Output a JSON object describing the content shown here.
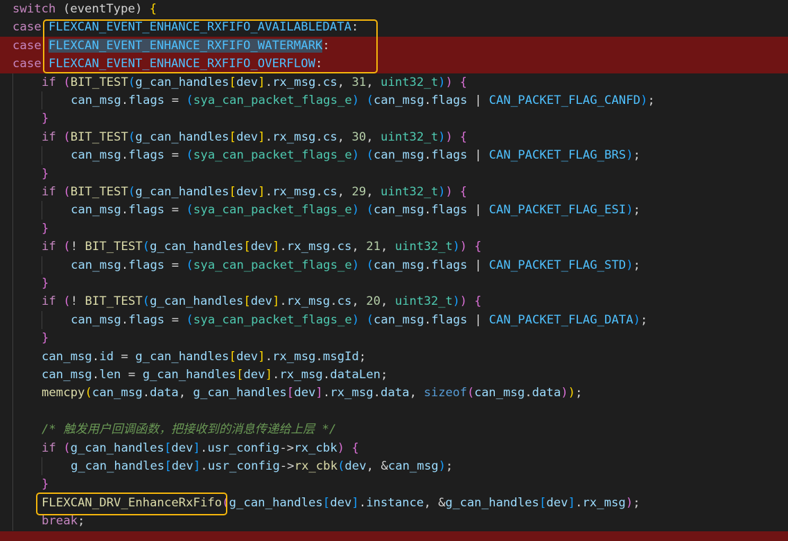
{
  "colors": {
    "background": "#1e1e1e",
    "highlight_line": "#6f1414",
    "annotation_box": "#f5b60c",
    "keyword": "#c586c0",
    "control": "#569cd6",
    "function": "#dcdcaa",
    "variable": "#9cdcfe",
    "type": "#4ec9b0",
    "number": "#b5cea8",
    "constant": "#4fc1ff",
    "comment": "#6a9955",
    "plain": "#d4d4d4",
    "bracket_gold": "#ffd700",
    "bracket_purple": "#da70d6",
    "bracket_blue": "#179fff"
  },
  "lines": [
    {
      "hl": false,
      "indent": 0,
      "tokens": [
        [
          "switch",
          "c"
        ],
        [
          " (",
          "p"
        ],
        [
          "eventType",
          "p"
        ],
        [
          ") ",
          "p"
        ],
        [
          "{",
          "bg"
        ]
      ]
    },
    {
      "hl": false,
      "indent": 0,
      "tokens": [
        [
          "case",
          "c"
        ],
        [
          " ",
          "p"
        ],
        [
          "FLEXCAN_EVENT_ENHANCE_RXFIFO_AVAILABLEDATA",
          "k"
        ],
        [
          ":",
          "p"
        ]
      ]
    },
    {
      "hl": true,
      "indent": 0,
      "tokens": [
        [
          "case",
          "c"
        ],
        [
          " ",
          "p"
        ],
        [
          "FLEXCAN_EVENT_ENHANCE_RXFIFO_WATERMARK",
          "ks"
        ],
        [
          ":",
          "p"
        ]
      ]
    },
    {
      "hl": true,
      "indent": 0,
      "tokens": [
        [
          "case",
          "c"
        ],
        [
          " ",
          "p"
        ],
        [
          "FLEXCAN_EVENT_ENHANCE_RXFIFO_OVERFLOW",
          "k"
        ],
        [
          ":",
          "p"
        ]
      ]
    },
    {
      "hl": false,
      "indent": 1,
      "tokens": [
        [
          "if",
          "c"
        ],
        [
          " ",
          "p"
        ],
        [
          "(",
          "bp"
        ],
        [
          "BIT_TEST",
          "f"
        ],
        [
          "(",
          "bb"
        ],
        [
          "g_can_handles",
          "v"
        ],
        [
          "[",
          "bg"
        ],
        [
          "dev",
          "v"
        ],
        [
          "]",
          "bg"
        ],
        [
          ".",
          "p"
        ],
        [
          "rx_msg",
          "v"
        ],
        [
          ".",
          "p"
        ],
        [
          "cs",
          "v"
        ],
        [
          ", ",
          "p"
        ],
        [
          "31",
          "n"
        ],
        [
          ", ",
          "p"
        ],
        [
          "uint32_t",
          "t"
        ],
        [
          ")",
          "bb"
        ],
        [
          ")",
          "bp"
        ],
        [
          " ",
          "p"
        ],
        [
          "{",
          "bp"
        ]
      ]
    },
    {
      "hl": false,
      "indent": 2,
      "tokens": [
        [
          "can_msg",
          "v"
        ],
        [
          ".",
          "p"
        ],
        [
          "flags",
          "v"
        ],
        [
          " = ",
          "p"
        ],
        [
          "(",
          "bb"
        ],
        [
          "sya_can_packet_flags_e",
          "t"
        ],
        [
          ")",
          "bb"
        ],
        [
          " ",
          "p"
        ],
        [
          "(",
          "bb"
        ],
        [
          "can_msg",
          "v"
        ],
        [
          ".",
          "p"
        ],
        [
          "flags",
          "v"
        ],
        [
          " | ",
          "p"
        ],
        [
          "CAN_PACKET_FLAG_CANFD",
          "k"
        ],
        [
          ")",
          "bb"
        ],
        [
          ";",
          "p"
        ]
      ]
    },
    {
      "hl": false,
      "indent": 1,
      "tokens": [
        [
          "}",
          "bp"
        ]
      ]
    },
    {
      "hl": false,
      "indent": 1,
      "tokens": [
        [
          "if",
          "c"
        ],
        [
          " ",
          "p"
        ],
        [
          "(",
          "bp"
        ],
        [
          "BIT_TEST",
          "f"
        ],
        [
          "(",
          "bb"
        ],
        [
          "g_can_handles",
          "v"
        ],
        [
          "[",
          "bg"
        ],
        [
          "dev",
          "v"
        ],
        [
          "]",
          "bg"
        ],
        [
          ".",
          "p"
        ],
        [
          "rx_msg",
          "v"
        ],
        [
          ".",
          "p"
        ],
        [
          "cs",
          "v"
        ],
        [
          ", ",
          "p"
        ],
        [
          "30",
          "n"
        ],
        [
          ", ",
          "p"
        ],
        [
          "uint32_t",
          "t"
        ],
        [
          ")",
          "bb"
        ],
        [
          ")",
          "bp"
        ],
        [
          " ",
          "p"
        ],
        [
          "{",
          "bp"
        ]
      ]
    },
    {
      "hl": false,
      "indent": 2,
      "tokens": [
        [
          "can_msg",
          "v"
        ],
        [
          ".",
          "p"
        ],
        [
          "flags",
          "v"
        ],
        [
          " = ",
          "p"
        ],
        [
          "(",
          "bb"
        ],
        [
          "sya_can_packet_flags_e",
          "t"
        ],
        [
          ")",
          "bb"
        ],
        [
          " ",
          "p"
        ],
        [
          "(",
          "bb"
        ],
        [
          "can_msg",
          "v"
        ],
        [
          ".",
          "p"
        ],
        [
          "flags",
          "v"
        ],
        [
          " | ",
          "p"
        ],
        [
          "CAN_PACKET_FLAG_BRS",
          "k"
        ],
        [
          ")",
          "bb"
        ],
        [
          ";",
          "p"
        ]
      ]
    },
    {
      "hl": false,
      "indent": 1,
      "tokens": [
        [
          "}",
          "bp"
        ]
      ]
    },
    {
      "hl": false,
      "indent": 1,
      "tokens": [
        [
          "if",
          "c"
        ],
        [
          " ",
          "p"
        ],
        [
          "(",
          "bp"
        ],
        [
          "BIT_TEST",
          "f"
        ],
        [
          "(",
          "bb"
        ],
        [
          "g_can_handles",
          "v"
        ],
        [
          "[",
          "bg"
        ],
        [
          "dev",
          "v"
        ],
        [
          "]",
          "bg"
        ],
        [
          ".",
          "p"
        ],
        [
          "rx_msg",
          "v"
        ],
        [
          ".",
          "p"
        ],
        [
          "cs",
          "v"
        ],
        [
          ", ",
          "p"
        ],
        [
          "29",
          "n"
        ],
        [
          ", ",
          "p"
        ],
        [
          "uint32_t",
          "t"
        ],
        [
          ")",
          "bb"
        ],
        [
          ")",
          "bp"
        ],
        [
          " ",
          "p"
        ],
        [
          "{",
          "bp"
        ]
      ]
    },
    {
      "hl": false,
      "indent": 2,
      "tokens": [
        [
          "can_msg",
          "v"
        ],
        [
          ".",
          "p"
        ],
        [
          "flags",
          "v"
        ],
        [
          " = ",
          "p"
        ],
        [
          "(",
          "bb"
        ],
        [
          "sya_can_packet_flags_e",
          "t"
        ],
        [
          ")",
          "bb"
        ],
        [
          " ",
          "p"
        ],
        [
          "(",
          "bb"
        ],
        [
          "can_msg",
          "v"
        ],
        [
          ".",
          "p"
        ],
        [
          "flags",
          "v"
        ],
        [
          " | ",
          "p"
        ],
        [
          "CAN_PACKET_FLAG_ESI",
          "k"
        ],
        [
          ")",
          "bb"
        ],
        [
          ";",
          "p"
        ]
      ]
    },
    {
      "hl": false,
      "indent": 1,
      "tokens": [
        [
          "}",
          "bp"
        ]
      ]
    },
    {
      "hl": false,
      "indent": 1,
      "tokens": [
        [
          "if",
          "c"
        ],
        [
          " ",
          "p"
        ],
        [
          "(",
          "bp"
        ],
        [
          "! ",
          "p"
        ],
        [
          "BIT_TEST",
          "f"
        ],
        [
          "(",
          "bb"
        ],
        [
          "g_can_handles",
          "v"
        ],
        [
          "[",
          "bg"
        ],
        [
          "dev",
          "v"
        ],
        [
          "]",
          "bg"
        ],
        [
          ".",
          "p"
        ],
        [
          "rx_msg",
          "v"
        ],
        [
          ".",
          "p"
        ],
        [
          "cs",
          "v"
        ],
        [
          ", ",
          "p"
        ],
        [
          "21",
          "n"
        ],
        [
          ", ",
          "p"
        ],
        [
          "uint32_t",
          "t"
        ],
        [
          ")",
          "bb"
        ],
        [
          ")",
          "bp"
        ],
        [
          " ",
          "p"
        ],
        [
          "{",
          "bp"
        ]
      ]
    },
    {
      "hl": false,
      "indent": 2,
      "tokens": [
        [
          "can_msg",
          "v"
        ],
        [
          ".",
          "p"
        ],
        [
          "flags",
          "v"
        ],
        [
          " = ",
          "p"
        ],
        [
          "(",
          "bb"
        ],
        [
          "sya_can_packet_flags_e",
          "t"
        ],
        [
          ")",
          "bb"
        ],
        [
          " ",
          "p"
        ],
        [
          "(",
          "bb"
        ],
        [
          "can_msg",
          "v"
        ],
        [
          ".",
          "p"
        ],
        [
          "flags",
          "v"
        ],
        [
          " | ",
          "p"
        ],
        [
          "CAN_PACKET_FLAG_STD",
          "k"
        ],
        [
          ")",
          "bb"
        ],
        [
          ";",
          "p"
        ]
      ]
    },
    {
      "hl": false,
      "indent": 1,
      "tokens": [
        [
          "}",
          "bp"
        ]
      ]
    },
    {
      "hl": false,
      "indent": 1,
      "tokens": [
        [
          "if",
          "c"
        ],
        [
          " ",
          "p"
        ],
        [
          "(",
          "bp"
        ],
        [
          "! ",
          "p"
        ],
        [
          "BIT_TEST",
          "f"
        ],
        [
          "(",
          "bb"
        ],
        [
          "g_can_handles",
          "v"
        ],
        [
          "[",
          "bg"
        ],
        [
          "dev",
          "v"
        ],
        [
          "]",
          "bg"
        ],
        [
          ".",
          "p"
        ],
        [
          "rx_msg",
          "v"
        ],
        [
          ".",
          "p"
        ],
        [
          "cs",
          "v"
        ],
        [
          ", ",
          "p"
        ],
        [
          "20",
          "n"
        ],
        [
          ", ",
          "p"
        ],
        [
          "uint32_t",
          "t"
        ],
        [
          ")",
          "bb"
        ],
        [
          ")",
          "bp"
        ],
        [
          " ",
          "p"
        ],
        [
          "{",
          "bp"
        ]
      ]
    },
    {
      "hl": false,
      "indent": 2,
      "tokens": [
        [
          "can_msg",
          "v"
        ],
        [
          ".",
          "p"
        ],
        [
          "flags",
          "v"
        ],
        [
          " = ",
          "p"
        ],
        [
          "(",
          "bb"
        ],
        [
          "sya_can_packet_flags_e",
          "t"
        ],
        [
          ")",
          "bb"
        ],
        [
          " ",
          "p"
        ],
        [
          "(",
          "bb"
        ],
        [
          "can_msg",
          "v"
        ],
        [
          ".",
          "p"
        ],
        [
          "flags",
          "v"
        ],
        [
          " | ",
          "p"
        ],
        [
          "CAN_PACKET_FLAG_DATA",
          "k"
        ],
        [
          ")",
          "bb"
        ],
        [
          ";",
          "p"
        ]
      ]
    },
    {
      "hl": false,
      "indent": 1,
      "tokens": [
        [
          "}",
          "bp"
        ]
      ]
    },
    {
      "hl": false,
      "indent": 1,
      "tokens": [
        [
          "can_msg",
          "v"
        ],
        [
          ".",
          "p"
        ],
        [
          "id",
          "v"
        ],
        [
          " = ",
          "p"
        ],
        [
          "g_can_handles",
          "v"
        ],
        [
          "[",
          "bg"
        ],
        [
          "dev",
          "v"
        ],
        [
          "]",
          "bg"
        ],
        [
          ".",
          "p"
        ],
        [
          "rx_msg",
          "v"
        ],
        [
          ".",
          "p"
        ],
        [
          "msgId",
          "v"
        ],
        [
          ";",
          "p"
        ]
      ]
    },
    {
      "hl": false,
      "indent": 1,
      "tokens": [
        [
          "can_msg",
          "v"
        ],
        [
          ".",
          "p"
        ],
        [
          "len",
          "v"
        ],
        [
          " = ",
          "p"
        ],
        [
          "g_can_handles",
          "v"
        ],
        [
          "[",
          "bg"
        ],
        [
          "dev",
          "v"
        ],
        [
          "]",
          "bg"
        ],
        [
          ".",
          "p"
        ],
        [
          "rx_msg",
          "v"
        ],
        [
          ".",
          "p"
        ],
        [
          "dataLen",
          "v"
        ],
        [
          ";",
          "p"
        ]
      ]
    },
    {
      "hl": false,
      "indent": 1,
      "tokens": [
        [
          "memcpy",
          "f"
        ],
        [
          "(",
          "bg"
        ],
        [
          "can_msg",
          "v"
        ],
        [
          ".",
          "p"
        ],
        [
          "data",
          "v"
        ],
        [
          ", ",
          "p"
        ],
        [
          "g_can_handles",
          "v"
        ],
        [
          "[",
          "bp"
        ],
        [
          "dev",
          "v"
        ],
        [
          "]",
          "bp"
        ],
        [
          ".",
          "p"
        ],
        [
          "rx_msg",
          "v"
        ],
        [
          ".",
          "p"
        ],
        [
          "data",
          "v"
        ],
        [
          ", ",
          "p"
        ],
        [
          "sizeof",
          "control"
        ],
        [
          "(",
          "bp"
        ],
        [
          "can_msg",
          "v"
        ],
        [
          ".",
          "p"
        ],
        [
          "data",
          "v"
        ],
        [
          ")",
          "bp"
        ],
        [
          ")",
          "bg"
        ],
        [
          ";",
          "p"
        ]
      ]
    },
    {
      "hl": false,
      "indent": 1,
      "tokens": []
    },
    {
      "hl": false,
      "indent": 1,
      "tokens": [
        [
          "/* 触发用户回调函数，把接收到的消息传递给上层 */",
          "cm"
        ]
      ]
    },
    {
      "hl": false,
      "indent": 1,
      "tokens": [
        [
          "if",
          "c"
        ],
        [
          " ",
          "p"
        ],
        [
          "(",
          "bp"
        ],
        [
          "g_can_handles",
          "v"
        ],
        [
          "[",
          "bb"
        ],
        [
          "dev",
          "v"
        ],
        [
          "]",
          "bb"
        ],
        [
          ".",
          "p"
        ],
        [
          "usr_config",
          "v"
        ],
        [
          "->",
          "p"
        ],
        [
          "rx_cbk",
          "v"
        ],
        [
          ")",
          "bp"
        ],
        [
          " ",
          "p"
        ],
        [
          "{",
          "bp"
        ]
      ]
    },
    {
      "hl": false,
      "indent": 2,
      "tokens": [
        [
          "g_can_handles",
          "v"
        ],
        [
          "[",
          "bb"
        ],
        [
          "dev",
          "v"
        ],
        [
          "]",
          "bb"
        ],
        [
          ".",
          "p"
        ],
        [
          "usr_config",
          "v"
        ],
        [
          "->",
          "p"
        ],
        [
          "rx_cbk",
          "f"
        ],
        [
          "(",
          "bb"
        ],
        [
          "dev",
          "v"
        ],
        [
          ", ",
          "p"
        ],
        [
          "&",
          "p"
        ],
        [
          "can_msg",
          "v"
        ],
        [
          ")",
          "bb"
        ],
        [
          ";",
          "p"
        ]
      ]
    },
    {
      "hl": false,
      "indent": 1,
      "tokens": [
        [
          "}",
          "bp"
        ]
      ]
    },
    {
      "hl": false,
      "indent": 1,
      "tokens": [
        [
          "FLEXCAN_DRV_EnhanceRxFifo",
          "f"
        ],
        [
          "(",
          "bp"
        ],
        [
          "g_can_handles",
          "v"
        ],
        [
          "[",
          "bb"
        ],
        [
          "dev",
          "v"
        ],
        [
          "]",
          "bb"
        ],
        [
          ".",
          "p"
        ],
        [
          "instance",
          "v"
        ],
        [
          ", ",
          "p"
        ],
        [
          "&",
          "p"
        ],
        [
          "g_can_handles",
          "v"
        ],
        [
          "[",
          "bb"
        ],
        [
          "dev",
          "v"
        ],
        [
          "]",
          "bb"
        ],
        [
          ".",
          "p"
        ],
        [
          "rx_msg",
          "v"
        ],
        [
          ")",
          "bp"
        ],
        [
          ";",
          "p"
        ]
      ]
    },
    {
      "hl": false,
      "indent": 1,
      "tokens": [
        [
          "break",
          "c"
        ],
        [
          ";",
          "p"
        ]
      ]
    }
  ]
}
